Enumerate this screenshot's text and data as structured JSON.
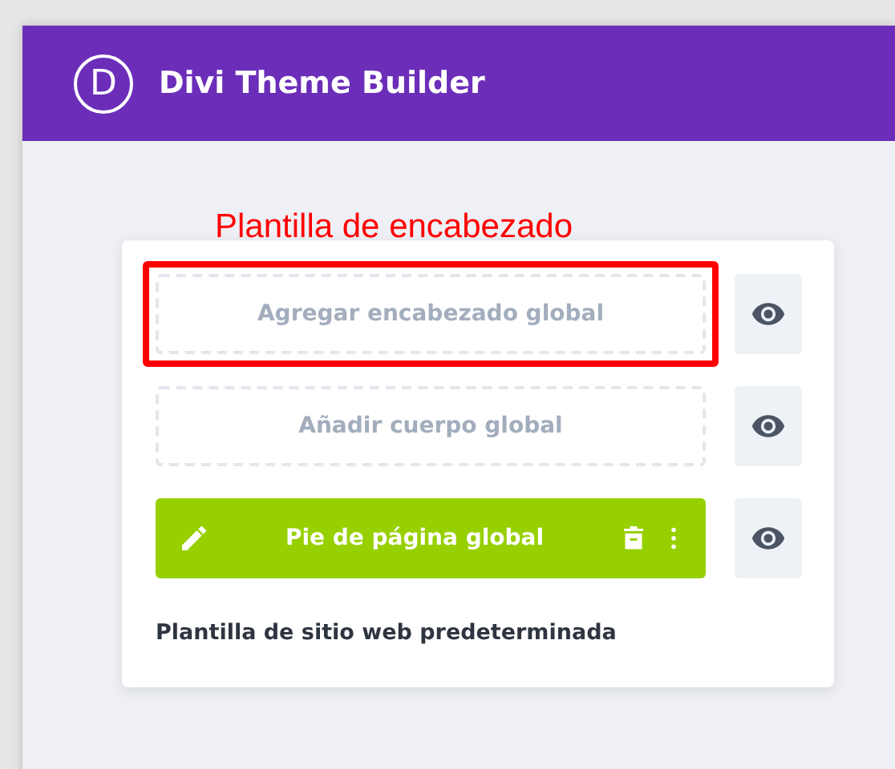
{
  "window": {
    "logo": "D",
    "title": "Divi Theme Builder"
  },
  "annotation": {
    "label": "Plantilla de encabezado"
  },
  "template": {
    "slots": [
      {
        "kind": "empty",
        "label": "Agregar encabezado global",
        "highlighted": true
      },
      {
        "kind": "empty",
        "label": "Añadir cuerpo global",
        "highlighted": false
      },
      {
        "kind": "filled",
        "label": "Pie de página global",
        "highlighted": false
      }
    ],
    "name": "Plantilla de sitio web predeterminada"
  }
}
